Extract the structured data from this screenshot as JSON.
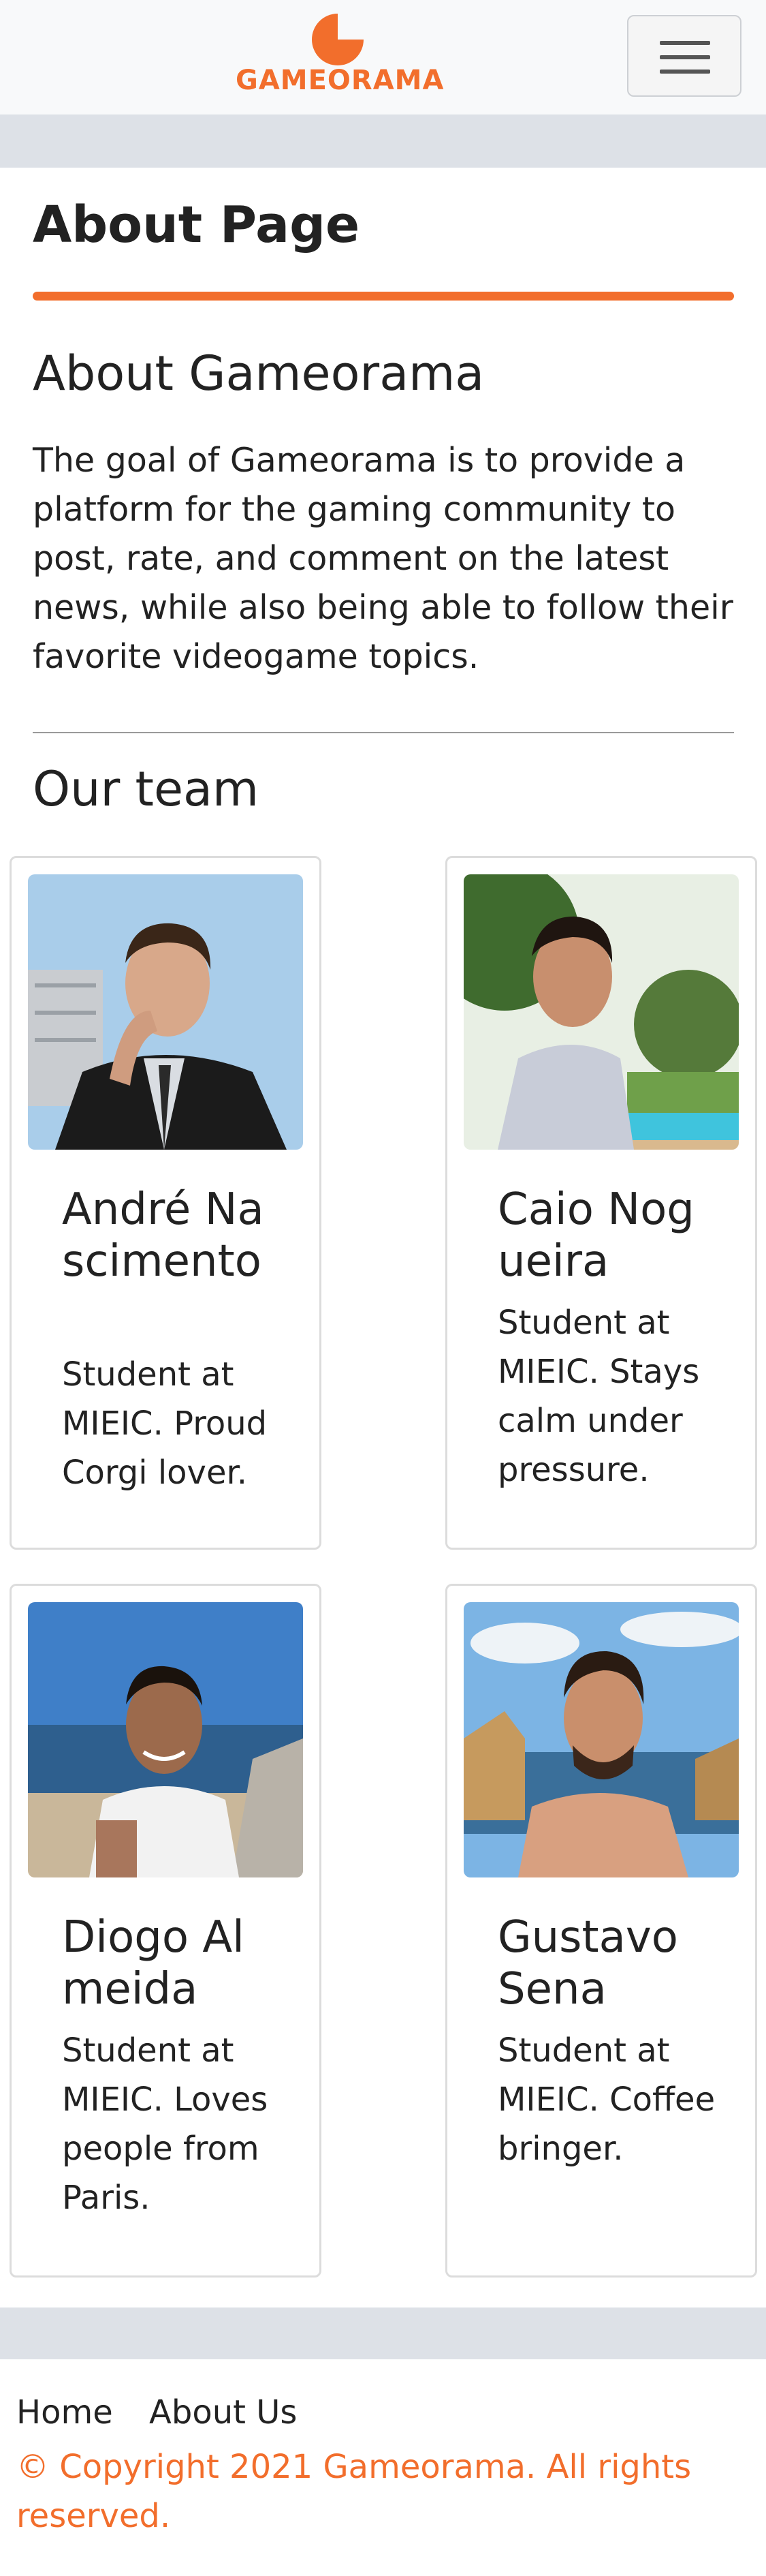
{
  "brand": {
    "logo_text": "GAMEORAMA",
    "accent_color": "#f26e2c"
  },
  "navbar": {
    "toggler_icon": "hamburger-icon"
  },
  "page": {
    "title": "About Page"
  },
  "about": {
    "heading": "About Gameorama",
    "text": "The goal of Gameorama is to provide a platform for the gaming community to post, rate, and comment on the latest news, while also being able to follow their favorite videogame topics."
  },
  "team": {
    "heading": "Our team",
    "members": [
      {
        "name": "André Nascimento",
        "bio": "Student at MIEIC. Proud Corgi lover."
      },
      {
        "name": "Caio Nogueira",
        "bio": "Student at MIEIC. Stays calm under pressure."
      },
      {
        "name": "Diogo Almeida",
        "bio": "Student at MIEIC. Loves people from Paris."
      },
      {
        "name": "Gustavo Sena",
        "bio": "Student at MIEIC. Coffee bringer."
      }
    ]
  },
  "footer": {
    "links": [
      "Home",
      "About Us"
    ],
    "copyright": "© Copyright 2021 Gameorama. All rights reserved."
  }
}
